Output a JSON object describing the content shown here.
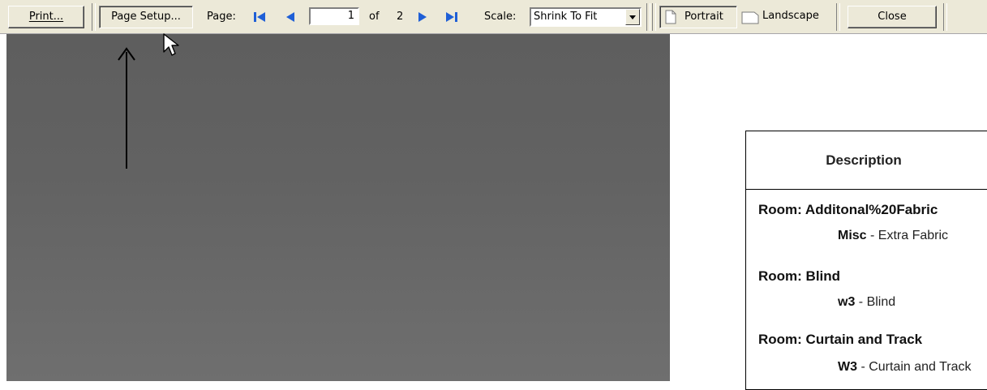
{
  "toolbar": {
    "print_label": "Print...",
    "page_setup_label": "Page Setup...",
    "page_label": "Page:",
    "current_page": "1",
    "of_label": "of",
    "total_pages": "2",
    "scale_label": "Scale:",
    "scale_value": "Shrink To Fit",
    "portrait_label": "Portrait",
    "landscape_label": "Landscape",
    "close_label": "Close"
  },
  "report": {
    "column_header": "Description",
    "groups": [
      {
        "room": "Room: Additonal%20Fabric",
        "code": "Misc",
        "desc": " - Extra Fabric"
      },
      {
        "room": "Room: Blind",
        "code": "w3",
        "desc": " - Blind"
      },
      {
        "room": "Room: Curtain and Track",
        "code": "W3",
        "desc": " - Curtain and Track"
      }
    ]
  },
  "colors": {
    "toolbar_bg": "#ece9d8",
    "nav_icon": "#1f5fd6",
    "viewer_bg": "#636363"
  },
  "icons": [
    "first-page-icon",
    "prev-page-icon",
    "next-page-icon",
    "last-page-icon",
    "dropdown-arrow-icon",
    "portrait-page-icon",
    "landscape-page-icon",
    "mouse-cursor-icon",
    "annotation-arrow"
  ]
}
